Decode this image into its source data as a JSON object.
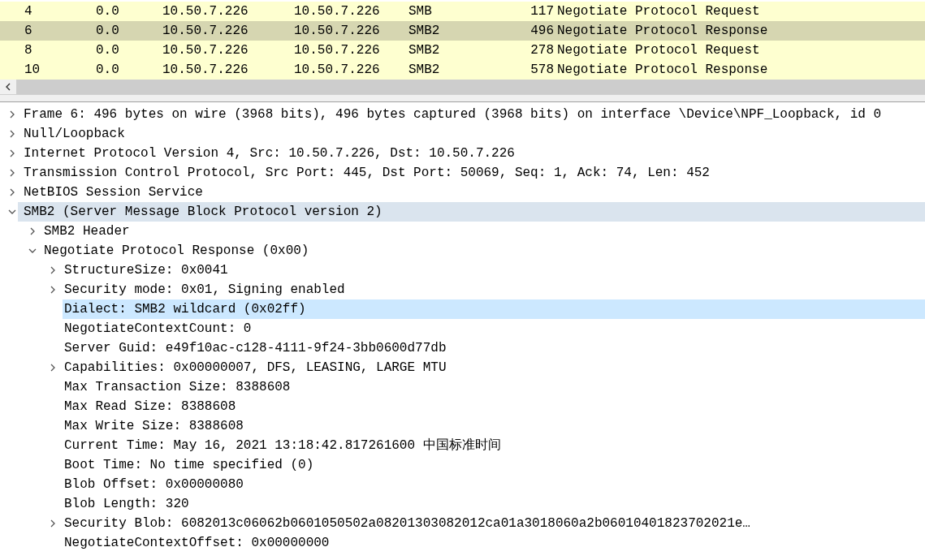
{
  "packet_list": {
    "rows": [
      {
        "no": "4",
        "time": "0.0",
        "source": "10.50.7.226",
        "destination": "10.50.7.226",
        "protocol": "SMB",
        "length": "117",
        "info": "Negotiate Protocol Request",
        "selected": false
      },
      {
        "no": "6",
        "time": "0.0",
        "source": "10.50.7.226",
        "destination": "10.50.7.226",
        "protocol": "SMB2",
        "length": "496",
        "info": "Negotiate Protocol Response",
        "selected": true
      },
      {
        "no": "8",
        "time": "0.0",
        "source": "10.50.7.226",
        "destination": "10.50.7.226",
        "protocol": "SMB2",
        "length": "278",
        "info": "Negotiate Protocol Request",
        "selected": false
      },
      {
        "no": "10",
        "time": "0.0",
        "source": "10.50.7.226",
        "destination": "10.50.7.226",
        "protocol": "SMB2",
        "length": "578",
        "info": "Negotiate Protocol Response",
        "selected": false
      }
    ]
  },
  "packet_details": {
    "items": [
      {
        "text": "Frame 6: 496 bytes on wire (3968 bits), 496 bytes captured (3968 bits) on interface \\Device\\NPF_Loopback, id 0",
        "expanded": false,
        "selected": false,
        "highlighted": false
      },
      {
        "text": "Null/Loopback",
        "expanded": false,
        "selected": false,
        "highlighted": false
      },
      {
        "text": "Internet Protocol Version 4, Src: 10.50.7.226, Dst: 10.50.7.226",
        "expanded": false,
        "selected": false,
        "highlighted": false
      },
      {
        "text": "Transmission Control Protocol, Src Port: 445, Dst Port: 50069, Seq: 1, Ack: 74, Len: 452",
        "expanded": false,
        "selected": false,
        "highlighted": false
      },
      {
        "text": "NetBIOS Session Service",
        "expanded": false,
        "selected": false,
        "highlighted": false
      },
      {
        "text": "SMB2 (Server Message Block Protocol version 2)",
        "expanded": true,
        "selected": false,
        "highlighted": true,
        "children": [
          {
            "text": "SMB2 Header",
            "expanded": false,
            "selected": false,
            "highlighted": false
          },
          {
            "text": "Negotiate Protocol Response (0x00)",
            "expanded": true,
            "selected": false,
            "highlighted": false,
            "children": [
              {
                "text": "StructureSize: 0x0041",
                "expanded": false,
                "selected": false,
                "highlighted": false
              },
              {
                "text": "Security mode: 0x01, Signing enabled",
                "expanded": false,
                "selected": false,
                "highlighted": false
              },
              {
                "text": "Dialect: SMB2 wildcard (0x02ff)",
                "selected": true,
                "highlighted": false
              },
              {
                "text": "NegotiateContextCount: 0",
                "selected": false,
                "highlighted": false
              },
              {
                "text": "Server Guid: e49f10ac-c128-4111-9f24-3bb0600d77db",
                "selected": false,
                "highlighted": false
              },
              {
                "text": "Capabilities: 0x00000007, DFS, LEASING, LARGE MTU",
                "expanded": false,
                "selected": false,
                "highlighted": false
              },
              {
                "text": "Max Transaction Size: 8388608",
                "selected": false,
                "highlighted": false
              },
              {
                "text": "Max Read Size: 8388608",
                "selected": false,
                "highlighted": false
              },
              {
                "text": "Max Write Size: 8388608",
                "selected": false,
                "highlighted": false
              },
              {
                "text": "Current Time: May 16, 2021 13:18:42.817261600 中国标准时间",
                "selected": false,
                "highlighted": false
              },
              {
                "text": "Boot Time: No time specified (0)",
                "selected": false,
                "highlighted": false
              },
              {
                "text": "Blob Offset: 0x00000080",
                "selected": false,
                "highlighted": false
              },
              {
                "text": "Blob Length: 320",
                "selected": false,
                "highlighted": false
              },
              {
                "text": "Security Blob: 6082013c06062b0601050502a08201303082012ca01a3018060a2b06010401823702021e…",
                "expanded": false,
                "selected": false,
                "highlighted": false
              },
              {
                "text": "NegotiateContextOffset: 0x00000000",
                "selected": false,
                "highlighted": false
              }
            ]
          }
        ]
      }
    ]
  }
}
